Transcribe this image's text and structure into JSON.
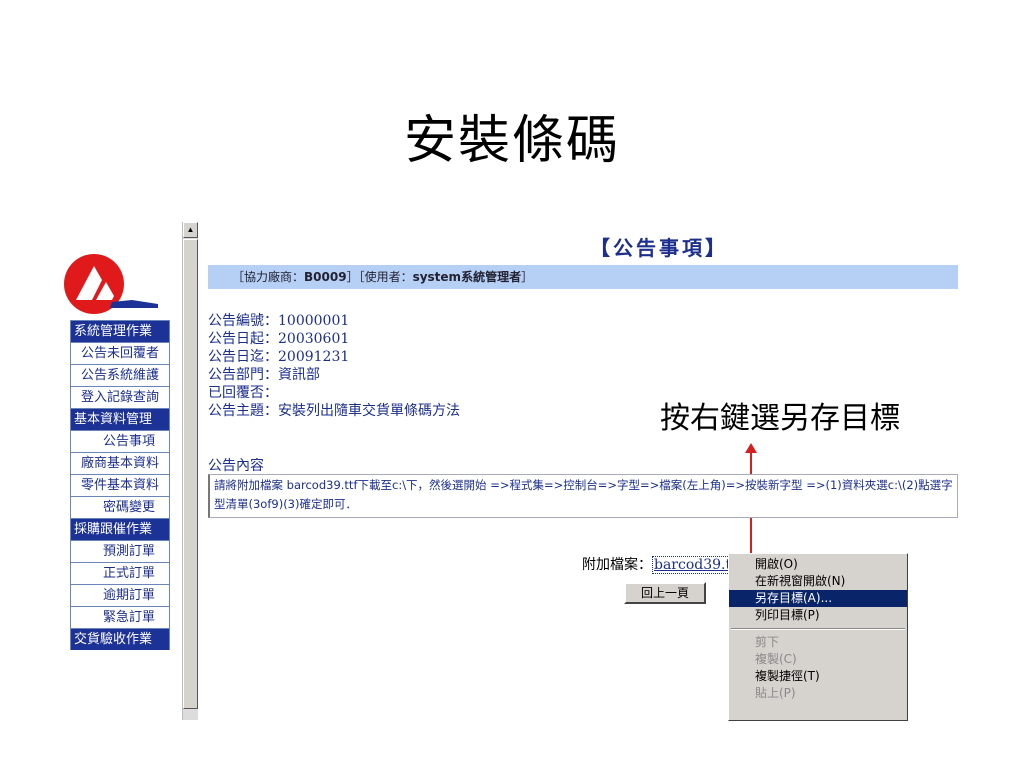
{
  "slide": {
    "title": "安裝條碼"
  },
  "sidebar": {
    "items": [
      {
        "label": "系統管理作業",
        "type": "head"
      },
      {
        "label": "公告未回覆者",
        "type": "item"
      },
      {
        "label": "公告系統維護",
        "type": "item"
      },
      {
        "label": "登入記錄查詢",
        "type": "item"
      },
      {
        "label": "基本資料管理",
        "type": "head"
      },
      {
        "label": "公告事項",
        "type": "indent"
      },
      {
        "label": "廠商基本資料",
        "type": "item"
      },
      {
        "label": "零件基本資料",
        "type": "item"
      },
      {
        "label": "密碼變更",
        "type": "indent"
      },
      {
        "label": "採購跟催作業",
        "type": "head"
      },
      {
        "label": "預測訂單",
        "type": "indent"
      },
      {
        "label": "正式訂單",
        "type": "indent"
      },
      {
        "label": "逾期訂單",
        "type": "indent"
      },
      {
        "label": "緊急訂單",
        "type": "indent"
      },
      {
        "label": "交貨驗收作業",
        "type": "head"
      }
    ]
  },
  "main": {
    "heading": "【公告事項】",
    "info_bar": {
      "prefix": "［協力廠商：",
      "vendor": "B0009",
      "middle": "］［使用者：",
      "user": "system系統管理者",
      "suffix": "］"
    },
    "details": [
      "公告編號：10000001",
      "公告日起：20030601",
      "公告日迄：20091231",
      "公告部門：資訊部",
      "已回覆否：",
      "公告主題：安裝列出隨車交貨單條碼方法"
    ],
    "content_label": "公告內容",
    "content_text": "請將附加檔案 barcod39.ttf下載至c:\\下，然後選開始 =>程式集=>控制台=>字型=>檔案(左上角)=>按裝新字型 =>(1)資料夾選c:\\(2)點選字型清單(3of9)(3)確定即可．",
    "attach_label": "附加檔案：",
    "attach_file": "barcod39.ttf",
    "back_button": "回上一頁"
  },
  "annotation": {
    "text": "按右鍵選另存目標",
    "arrow_color": "#d62020"
  },
  "context_menu": {
    "items": [
      {
        "label": "開啟(O)",
        "state": "normal"
      },
      {
        "label": "在新視窗開啟(N)",
        "state": "normal"
      },
      {
        "label": "另存目標(A)...",
        "state": "selected"
      },
      {
        "label": "列印目標(P)",
        "state": "normal"
      },
      {
        "label": "剪下",
        "state": "disabled"
      },
      {
        "label": "複製(C)",
        "state": "disabled"
      },
      {
        "label": "複製捷徑(T)",
        "state": "normal"
      },
      {
        "label": "貼上(P)",
        "state": "disabled"
      }
    ]
  },
  "colors": {
    "nav_head": "#1c3296",
    "info_bar": "#b5cff5",
    "logo_red": "#e0191b",
    "menu_highlight": "#0a246a"
  }
}
